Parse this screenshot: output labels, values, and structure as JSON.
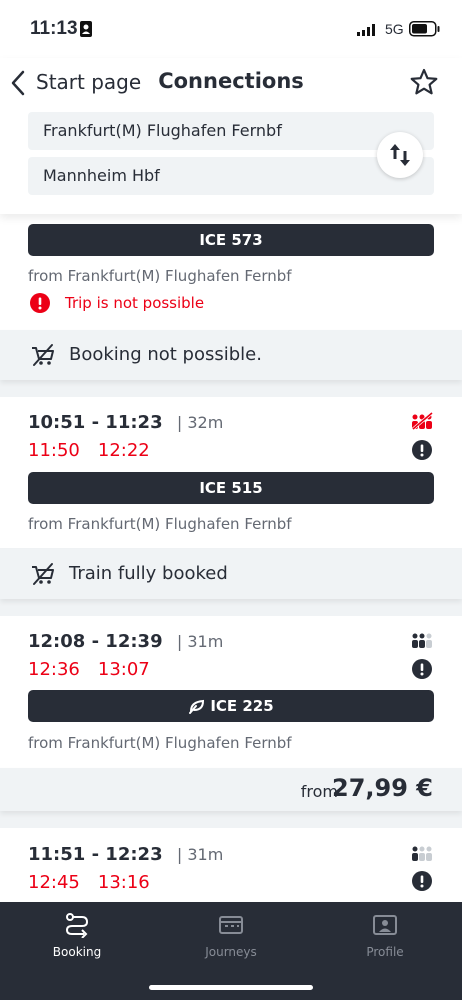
{
  "status_bar": {
    "time": "11:13",
    "network": "5G"
  },
  "header": {
    "back_label": "Start page",
    "title": "Connections",
    "from_station": "Frankfurt(M) Flughafen Fernbf",
    "to_station": "Mannheim Hbf"
  },
  "connections": [
    {
      "train": "ICE 573",
      "origin": "from Frankfurt(M) Flughafen Fernbf",
      "warning": "Trip is not possible",
      "banner": "Booking not possible."
    },
    {
      "times": "10:51 - 11:23",
      "duration": "| 32m",
      "rt_dep": "11:50",
      "rt_arr": "12:22",
      "train": "ICE 515",
      "origin": "from Frankfurt(M) Flughafen Fernbf",
      "banner": "Train fully booked"
    },
    {
      "times": "12:08 - 12:39",
      "duration": "| 31m",
      "rt_dep": "12:36",
      "rt_arr": "13:07",
      "train": "ICE 225",
      "origin": "from Frankfurt(M) Flughafen Fernbf",
      "price_prefix": "from",
      "price": "27,99 €"
    },
    {
      "times": "11:51 - 12:23",
      "duration": "| 31m",
      "rt_dep": "12:45",
      "rt_arr": "13:16"
    }
  ],
  "nav": [
    {
      "label": "Booking",
      "icon": "route-icon",
      "active": true
    },
    {
      "label": "Journeys",
      "icon": "ticket-icon",
      "active": false
    },
    {
      "label": "Profile",
      "icon": "profile-icon",
      "active": false
    }
  ],
  "colors": {
    "dark": "#282d37",
    "red": "#ec0016",
    "gray": "#646973",
    "bg": "#f0f3f5"
  }
}
